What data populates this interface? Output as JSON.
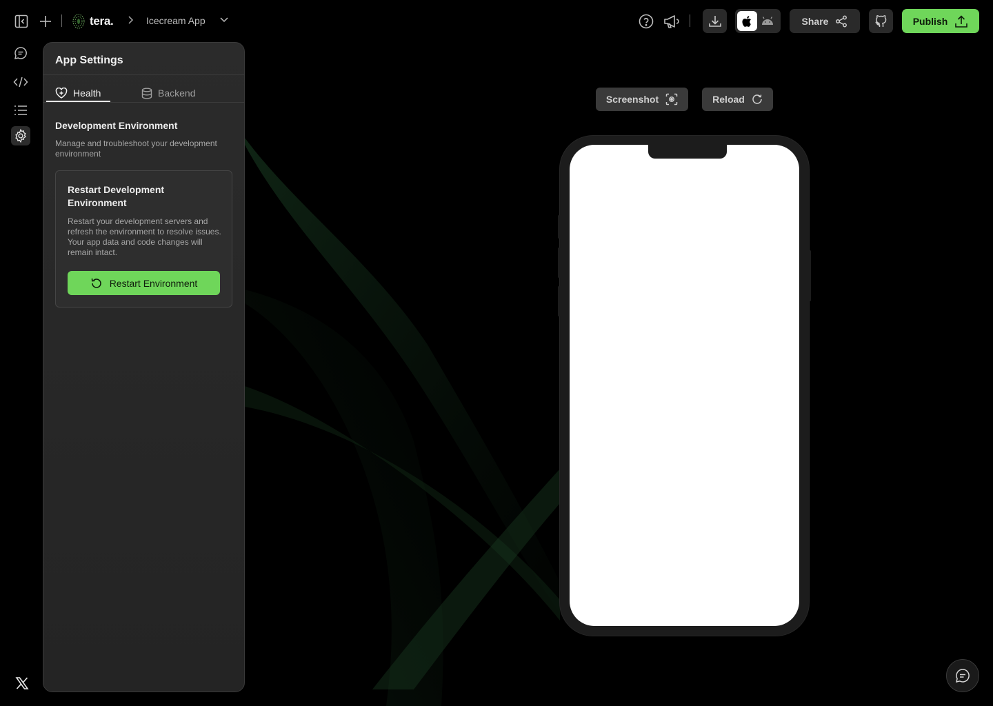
{
  "brand": {
    "name": "tera."
  },
  "project": {
    "name": "Icecream App"
  },
  "toolbar": {
    "share_label": "Share",
    "publish_label": "Publish"
  },
  "colors": {
    "accent": "#6fd65a",
    "panel_bg": "#2b2b2b",
    "page_bg": "#000000"
  },
  "panel": {
    "title": "App Settings",
    "tabs": [
      {
        "label": "Health",
        "icon": "heart-plus-icon",
        "active": true
      },
      {
        "label": "Backend",
        "icon": "database-icon",
        "active": false
      }
    ],
    "section": {
      "title": "Development Environment",
      "description": "Manage and troubleshoot your development environment"
    },
    "card": {
      "title": "Restart Development Environment",
      "description": "Restart your development servers and refresh the environment to resolve issues. Your app data and code changes will remain intact.",
      "button_label": "Restart Environment"
    }
  },
  "preview": {
    "screenshot_label": "Screenshot",
    "reload_label": "Reload"
  }
}
